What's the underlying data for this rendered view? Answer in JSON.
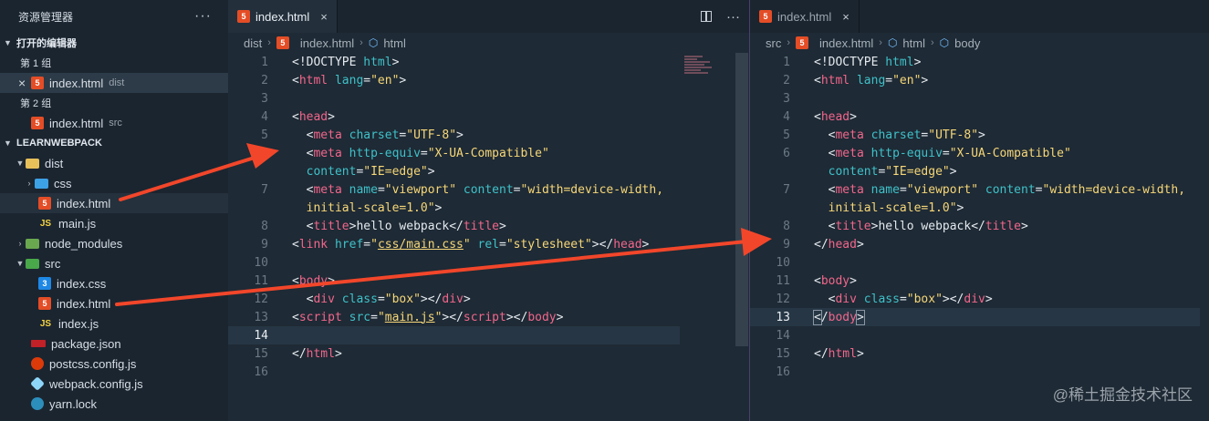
{
  "sidebar": {
    "title": "资源管理器",
    "more": "···",
    "open_editors_label": "打开的编辑器",
    "group1_label": "第 1 组",
    "group1_file": "index.html",
    "group1_file_sub": "dist",
    "group1_close": "×",
    "group2_label": "第 2 组",
    "group2_file": "index.html",
    "group2_file_sub": "src",
    "project_label": "LEARNWEBPACK",
    "tree": [
      {
        "label": "dist",
        "icon": "folder-icon"
      },
      {
        "label": "css",
        "icon": "css-folder-icon"
      },
      {
        "label": "index.html",
        "icon": "html5-icon"
      },
      {
        "label": "main.js",
        "icon": "js-icon"
      },
      {
        "label": "node_modules",
        "icon": "node-folder-icon"
      },
      {
        "label": "src",
        "icon": "src-folder-icon"
      },
      {
        "label": "index.css",
        "icon": "css3-icon"
      },
      {
        "label": "index.html",
        "icon": "html5-icon"
      },
      {
        "label": "index.js",
        "icon": "js-icon"
      },
      {
        "label": "package.json",
        "icon": "npm-icon"
      },
      {
        "label": "postcss.config.js",
        "icon": "postcss-icon"
      },
      {
        "label": "webpack.config.js",
        "icon": "webpack-icon"
      },
      {
        "label": "yarn.lock",
        "icon": "yarn-icon"
      }
    ]
  },
  "left_editor": {
    "tab_label": "index.html",
    "tab_close": "×",
    "breadcrumb": [
      "dist",
      "index.html",
      "html"
    ],
    "split_icon": "split-editor-icon",
    "more": "···"
  },
  "right_editor": {
    "tab_label": "index.html",
    "tab_close": "×",
    "breadcrumb": [
      "src",
      "index.html",
      "html",
      "body"
    ]
  },
  "line_numbers": [
    "1",
    "2",
    "3",
    "4",
    "5",
    "6",
    "7",
    "8",
    "9",
    "10",
    "11",
    "12",
    "13",
    "14",
    "15",
    "16"
  ],
  "watermark": "@稀土掘金技术社区",
  "colors": {
    "tag": "#f2668b",
    "attr": "#3fc1c9",
    "string": "#f7d778",
    "arrow": "#f2462a"
  }
}
